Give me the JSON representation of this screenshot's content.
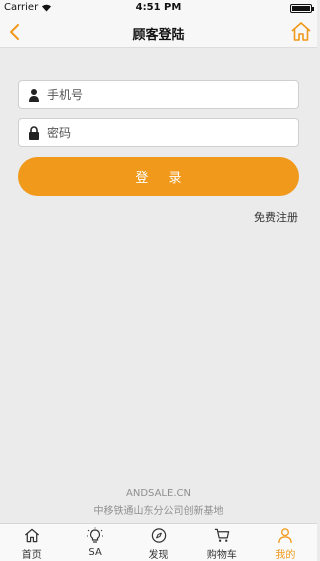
{
  "status_bar": {
    "carrier": "Carrier",
    "time": "4:51 PM"
  },
  "nav": {
    "title": "顾客登陆"
  },
  "form": {
    "phone_placeholder": "手机号",
    "password_placeholder": "密码",
    "login_label": "登 录",
    "register_label": "免费注册"
  },
  "footer": {
    "brand": "ANDSALE.CN",
    "subtitle": "中移铁通山东分公司创新基地"
  },
  "tabs": [
    {
      "label": "首页",
      "icon": "home-icon"
    },
    {
      "label": "SA",
      "icon": "lightbulb-icon"
    },
    {
      "label": "发现",
      "icon": "compass-icon"
    },
    {
      "label": "购物车",
      "icon": "cart-icon"
    },
    {
      "label": "我的",
      "icon": "user-icon",
      "active": true
    }
  ],
  "colors": {
    "accent": "#f0991a",
    "background": "#ebebeb"
  }
}
